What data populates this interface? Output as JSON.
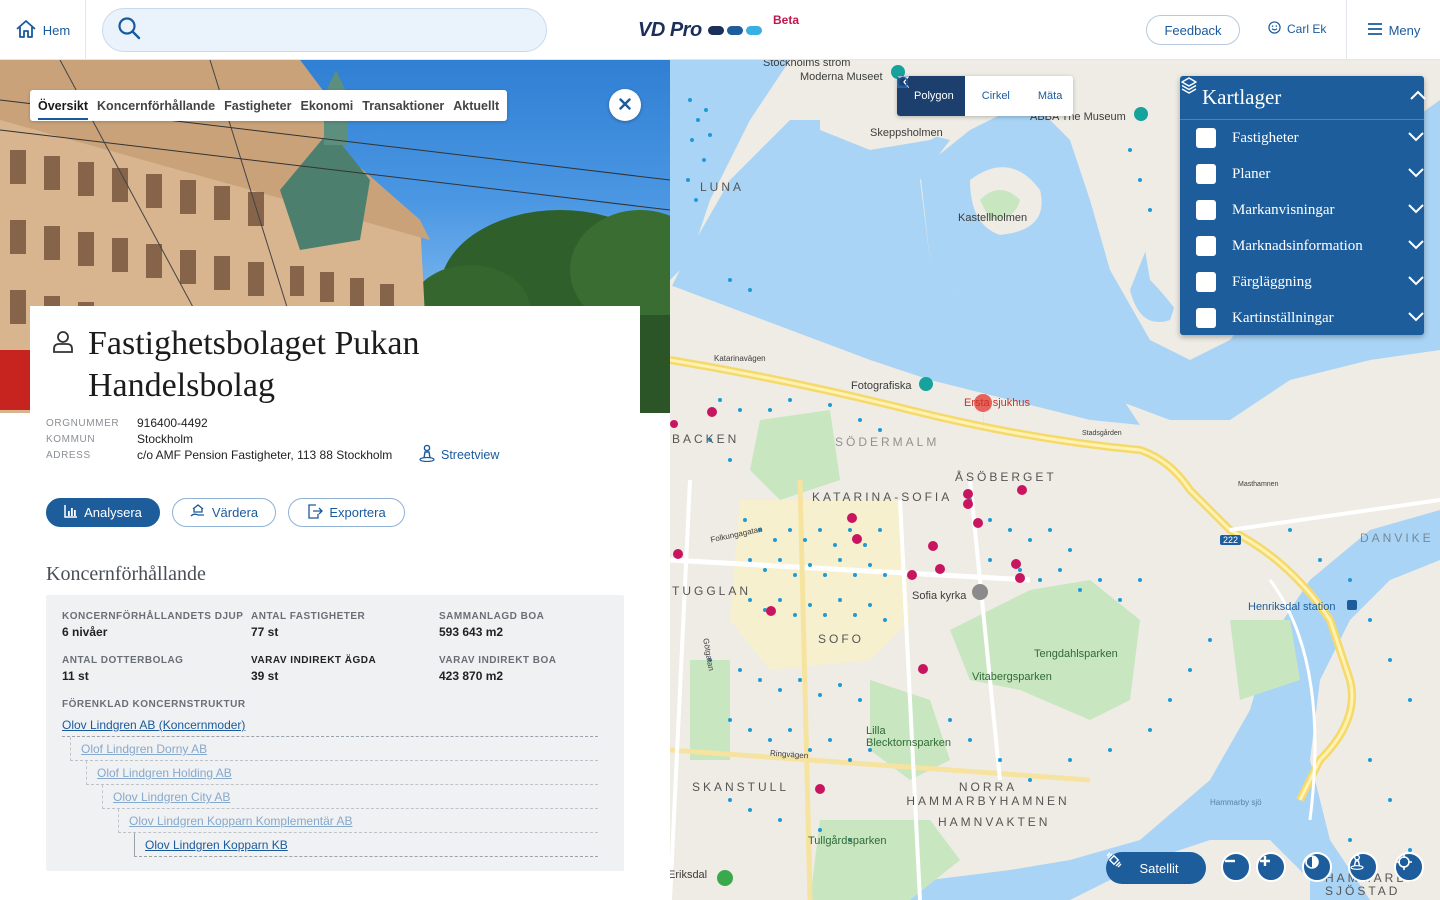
{
  "header": {
    "home_label": "Hem",
    "search_placeholder": "",
    "logo_text": "VD Pro",
    "logo_colors": [
      "#1c2f5a",
      "#1d5d9b",
      "#3ab0e2"
    ],
    "beta_label": "Beta",
    "feedback_label": "Feedback",
    "user_name": "Carl Ek",
    "menu_label": "Meny"
  },
  "tabs": [
    {
      "label": "Översikt",
      "active": true
    },
    {
      "label": "Koncernförhållande",
      "active": false
    },
    {
      "label": "Fastigheter",
      "active": false
    },
    {
      "label": "Ekonomi",
      "active": false
    },
    {
      "label": "Transaktioner",
      "active": false
    },
    {
      "label": "Aktuellt",
      "active": false
    }
  ],
  "company": {
    "name": "Fastighetsbolaget Pukan Handelsbolag",
    "fields": [
      {
        "key": "Orgnummer",
        "value": "916400-4492"
      },
      {
        "key": "Kommun",
        "value": "Stockholm"
      },
      {
        "key": "Adress",
        "value": "c/o AMF Pension Fastigheter, 113 88 Stockholm"
      }
    ],
    "streetview_label": "Streetview"
  },
  "actions": {
    "analyze": "Analysera",
    "value": "Värdera",
    "export": "Exportera"
  },
  "group": {
    "section_title": "Koncernförhållande",
    "stats": [
      {
        "key": "Koncernförhållandets djup",
        "value": "6 nivåer"
      },
      {
        "key": "Antal fastigheter",
        "value": "77 st"
      },
      {
        "key": "Sammanlagd BOA",
        "value": "593 643 m2"
      },
      {
        "key": "Antal dotterbolag",
        "value": "11 st"
      },
      {
        "key": "Varav indirekt ägda",
        "value": "39 st"
      },
      {
        "key": "Varav indirekt BOA",
        "value": "423 870 m2"
      }
    ],
    "structure_label": "FÖRENKLAD KONCERNSTRUKTUR",
    "structure": [
      "Olov Lindgren AB (Koncernmoder)",
      "Olof Lindgren Dorny AB",
      "Olof Lindgren Holding AB",
      "Olov Lindgren City AB",
      "Olov Lindgren Kopparn Komplementär AB",
      "Olov Lindgren Kopparn KB"
    ]
  },
  "map": {
    "draw_tools": [
      "Polygon",
      "Cirkel",
      "Mäta"
    ],
    "layers_title": "Kartlager",
    "layers": [
      "Fastigheter",
      "Planer",
      "Markanvisningar",
      "Marknadsinformation",
      "Färgläggning",
      "Kartinställningar"
    ],
    "satellite_label": "Satellit",
    "colors": {
      "water": "#a9d4f5",
      "land": "#eeece4",
      "park": "#c8e6c0",
      "road": "#f6d96b",
      "dot": "#1e9bd7",
      "marker": "#c8155f"
    },
    "labels": {
      "stockholm_strom": "Stockholms ström",
      "moderna_museet": "Moderna Museet",
      "skeppsholmen": "Skeppsholmen",
      "kastellholmen": "Kastellholmen",
      "abba": "ABBA The Museum",
      "fotografiska": "Fotografiska",
      "ersta": "Ersta sjukhus",
      "sodermalm": "Södermalm",
      "katarina_sofia": "Katarina-Sofia",
      "asoberget": "Åsöberget",
      "sofia_kyrka": "Sofia kyrka",
      "sofo": "SoFo",
      "tengdahlsparken": "Tengdahlsparken",
      "vitabergsparken": "Vitabergsparken",
      "lilla_blecktornsparken": "Lilla Blecktornsparken",
      "skanstull": "Skanstull",
      "norra_hammarbyhamnen": "Norra Hammarbyhamnen",
      "hamnvakten": "Hamnvakten",
      "tullgardsparken": "Tullgårdsparken",
      "henriksdal": "Henriksdal station",
      "danvike": "Danvike",
      "hammarby_sjo": "Hammarby sjö",
      "hammarby_sjostad": "Hammarby Sjöstad",
      "eriksdal": "Eriksdal",
      "luna": "Luna",
      "backen": "Backen",
      "tugglan": "Tugglan",
      "katarinavagen": "Katarinavägen",
      "folkungagatan": "Folkungagatan",
      "gotgatan": "Götgatan",
      "ringvagen": "Ringvägen",
      "masthamnen": "Masthamnen",
      "stadsgarden": "Stadsgården",
      "route_222": "222"
    }
  }
}
